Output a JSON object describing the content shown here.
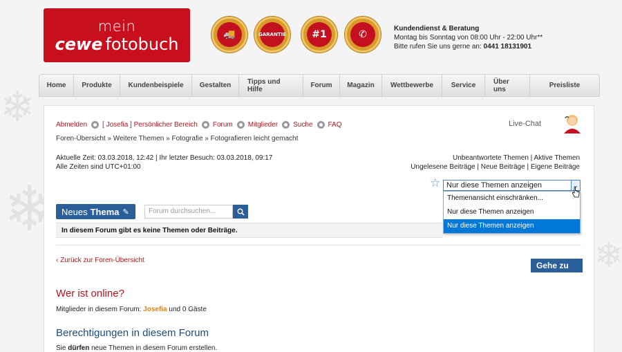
{
  "header": {
    "logo_line1": "mein",
    "logo_bold": "cewe",
    "logo_line2": "fotobuch",
    "badges": [
      "EXPRESS SERVICE",
      "GARANTIE",
      "#1",
      "SERVICE"
    ],
    "contact_title": "Kundendienst & Beratung",
    "contact_hours": "Montag bis Sonntag von 08:00 Uhr - 22:00 Uhr**",
    "contact_call_prefix": "Bitte rufen Sie uns gerne an:",
    "contact_phone": "0441 18131901"
  },
  "nav": [
    "Home",
    "Produkte",
    "Kundenbeispiele",
    "Gestalten",
    "Tipps und Hilfe",
    "Forum",
    "Magazin",
    "Wettbewerbe",
    "Service",
    "Über uns",
    "Preisliste"
  ],
  "forum": {
    "links": {
      "logout": "Abmelden",
      "personal": "[ Josefia ] Persönlicher Bereich",
      "forum": "Forum",
      "members": "Mitglieder",
      "search": "Suche",
      "faq": "FAQ"
    },
    "breadcrumb": "Foren-Übersicht » Weitere Themen » Fotografie » Fotografieren leicht gemacht",
    "live_chat": "Live-Chat",
    "time_line1": "Aktuelle Zeit: 03.03.2018, 12:42 | Ihr letzter Besuch: 03.03.2018, 09:17",
    "time_line2": "Alle Zeiten sind UTC+01:00",
    "right_line1": "Unbeantwortete Themen | Aktive Themen",
    "right_line2": "Ungelesene Beiträge | Neue Beiträge | Eigene Beiträge",
    "select_value": "Nur diese Themen anzeigen",
    "dropdown_options": [
      "Themenansicht einschränken...",
      "Nur diese Themen anzeigen",
      "Nur diese Themen anzeigen"
    ],
    "new_topic_prefix": "Neues",
    "new_topic_bold": "Thema",
    "search_placeholder": "Forum durchsuchen...",
    "empty_notice": "In diesem Forum gibt es keine Themen oder Beiträge.",
    "back_link": "Zurück zur Foren-Übersicht",
    "goto_button": "Gehe zu",
    "online_heading": "Wer ist online?",
    "online_prefix": "Mitglieder in diesem Forum:",
    "online_user": "Josefia",
    "online_suffix": "und 0 Gäste",
    "perm_heading": "Berechtigungen in diesem Forum",
    "perm_prefix": "Sie",
    "perm_bold": "dürfen",
    "perm_suffix": "neue Themen in diesem Forum erstellen."
  },
  "colors": {
    "brand_red": "#c80f1e",
    "link_red": "#b4141e",
    "button_blue": "#2b5f99",
    "selection_blue": "#0078d7"
  }
}
